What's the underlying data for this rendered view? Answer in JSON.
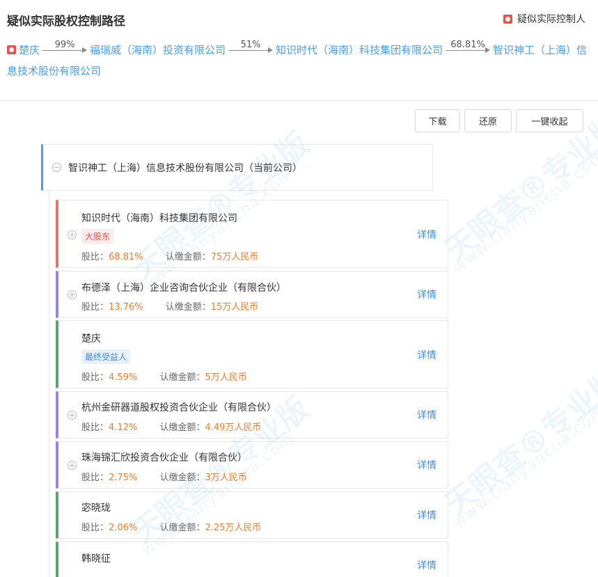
{
  "header": {
    "title": "疑似实际股权控制路径",
    "legend_label": "疑似实际控制人"
  },
  "path": {
    "start": "楚庆",
    "steps": [
      {
        "pct": "99%",
        "name": "福瑞威（海南）投资有限公司"
      },
      {
        "pct": "51%",
        "name": "知识时代（海南）科技集团有限公司"
      },
      {
        "pct": "68.81%",
        "name": "智识神工（上海）信息技术股份有限公司"
      }
    ]
  },
  "toolbar": {
    "download": "下载",
    "restore": "还原",
    "collapse_all": "一键收起"
  },
  "watermark": {
    "brand": "天眼查",
    "suffix": "专业版",
    "url": "www.tianyancha.com"
  },
  "tree": {
    "root_label": "智识神工（上海）信息技术股份有限公司（当前公司）",
    "ratio_label": "股比：",
    "amount_label": "认缴金额：",
    "detail_label": "详情",
    "shareholders": [
      {
        "name": "知识时代（海南）科技集团有限公司",
        "tag": "大股东",
        "ratio": "68.81%",
        "amount": "75万人民币"
      },
      {
        "name": "布德泽（上海）企业咨询合伙企业（有限合伙）",
        "tag": "",
        "ratio": "13.76%",
        "amount": "15万人民币"
      },
      {
        "name": "楚庆",
        "tag": "最终受益人",
        "ratio": "4.59%",
        "amount": "5万人民币"
      },
      {
        "name": "杭州金研器道股权投资合伙企业（有限合伙）",
        "tag": "",
        "ratio": "4.12%",
        "amount": "4.49万人民币"
      },
      {
        "name": "珠海锦汇欣投资合伙企业（有限合伙）",
        "tag": "",
        "ratio": "2.75%",
        "amount": "3万人民币"
      },
      {
        "name": "宓晓珑",
        "tag": "",
        "ratio": "2.06%",
        "amount": "2.25万人民币"
      },
      {
        "name": "韩晓征",
        "tag": "",
        "ratio": "",
        "amount": ""
      }
    ]
  },
  "colors": {
    "accent": "#4a9ee6",
    "company_bar": "#e57366",
    "partnership_bar": "#9b83d8",
    "person_bar": "#5ba56b",
    "value": "#f07b2a",
    "tag_major_bg": "#fdeceb",
    "tag_major_fg": "#e8524c",
    "tag_benef_bg": "#e6f1fc",
    "tag_benef_fg": "#3c8ce7"
  }
}
